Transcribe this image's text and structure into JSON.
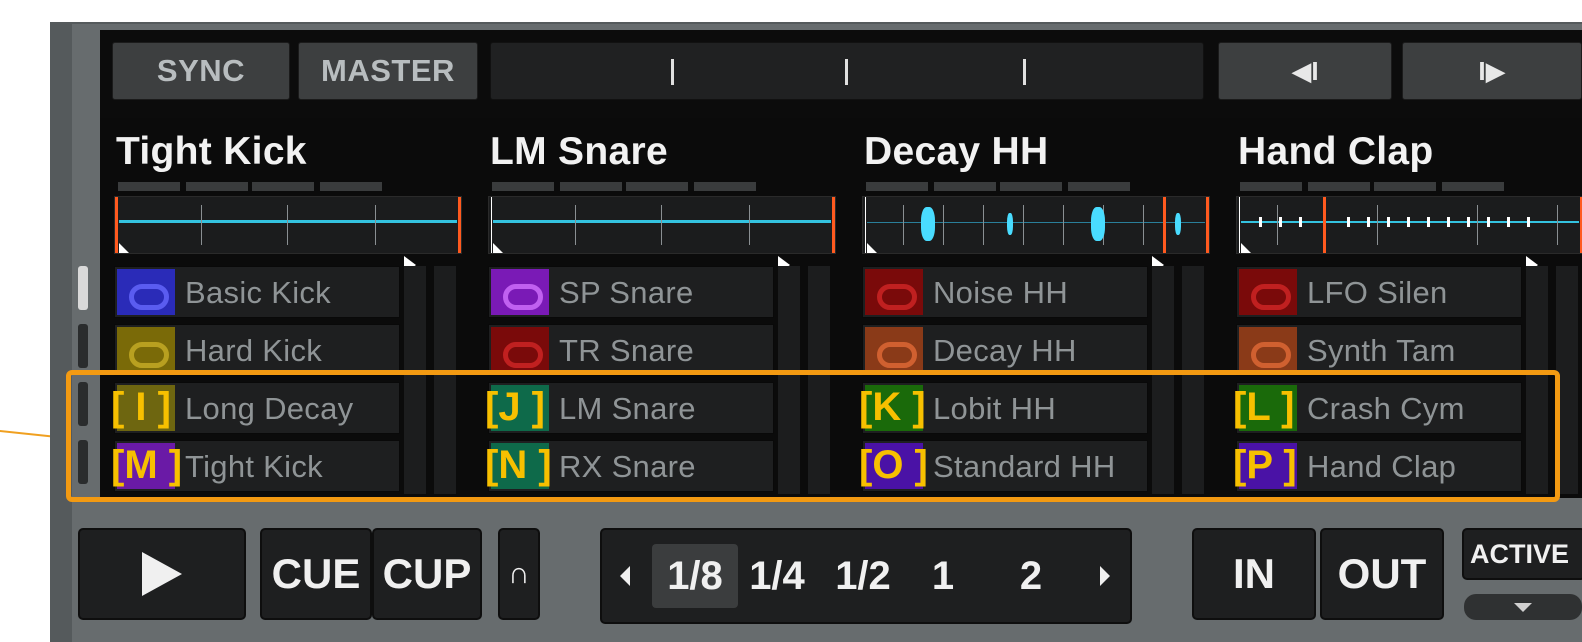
{
  "annotation": {
    "highlight_color": "#f39a12"
  },
  "topbar": {
    "sync_label": "SYNC",
    "master_label": "MASTER",
    "jump_back_icon": "skip-back-icon",
    "jump_forward_icon": "skip-forward-icon"
  },
  "slots": [
    {
      "title": "Tight Kick",
      "samples": [
        {
          "label": "Basic Kick",
          "color": "#2a2bb8",
          "letter": ""
        },
        {
          "label": "Hard Kick",
          "color": "#7a6a08",
          "letter": ""
        },
        {
          "label": "Long Decay",
          "color": "#6e6610",
          "letter": "[ I ]"
        },
        {
          "label": "Tight Kick",
          "color": "#6a1aa6",
          "letter": "[M ]"
        }
      ]
    },
    {
      "title": "LM Snare",
      "samples": [
        {
          "label": "SP Snare",
          "color": "#7a1ab6",
          "letter": ""
        },
        {
          "label": "TR Snare",
          "color": "#7a0a0a",
          "letter": ""
        },
        {
          "label": "LM Snare",
          "color": "#0e6a4a",
          "letter": "[J ]"
        },
        {
          "label": "RX Snare",
          "color": "#0e6a4a",
          "letter": "[N ]"
        }
      ]
    },
    {
      "title": "Decay HH",
      "samples": [
        {
          "label": "Noise HH",
          "color": "#7a0a0a",
          "letter": ""
        },
        {
          "label": "Decay HH",
          "color": "#8a3a18",
          "letter": ""
        },
        {
          "label": "Lobit HH",
          "color": "#1a6a0a",
          "letter": "[K ]"
        },
        {
          "label": "Standard HH",
          "color": "#4a12a6",
          "letter": "[O ]"
        }
      ]
    },
    {
      "title": "Hand Clap",
      "samples": [
        {
          "label": "LFO Silen",
          "color": "#7a0a0a",
          "letter": ""
        },
        {
          "label": "Synth Tam",
          "color": "#8a3a18",
          "letter": ""
        },
        {
          "label": "Crash Cym",
          "color": "#1a6a0a",
          "letter": "[L ]"
        },
        {
          "label": "Hand Clap",
          "color": "#4a12a6",
          "letter": "[P ]"
        }
      ]
    }
  ],
  "transport": {
    "play_icon": "play-icon",
    "cue_label": "CUE",
    "cup_label": "CUP",
    "loop_icon": "loop-icon"
  },
  "quantize": {
    "options": [
      "1/8",
      "1/4",
      "1/2",
      "1",
      "2"
    ],
    "selected": "1/8"
  },
  "loop_controls": {
    "in_label": "IN",
    "out_label": "OUT",
    "active_label": "ACTIVE"
  }
}
